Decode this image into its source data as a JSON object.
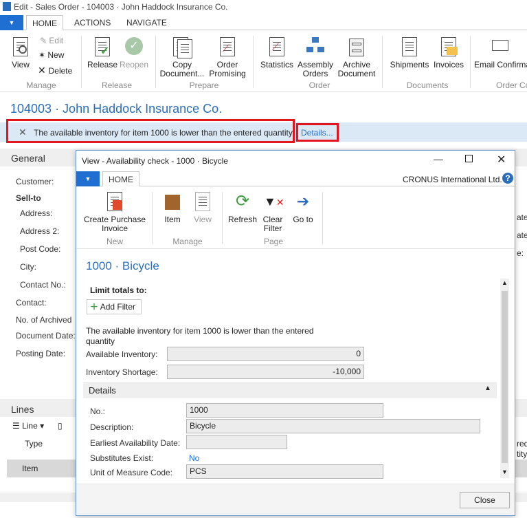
{
  "window": {
    "title": "Edit - Sales Order - 104003 · John Haddock Insurance Co."
  },
  "ribbon_tabs": [
    "HOME",
    "ACTIONS",
    "NAVIGATE"
  ],
  "ribbon": {
    "view": "View",
    "edit": "Edit",
    "new": "New",
    "delete": "Delete",
    "release": "Release",
    "reopen": "Reopen",
    "copy_document": "Copy Document...",
    "order_promising": "Order Promising",
    "statistics": "Statistics",
    "assembly_orders": "Assembly Orders",
    "archive_document": "Archive Document",
    "shipments": "Shipments",
    "invoices": "Invoices",
    "email_confirmation": "Email Confirmation...",
    "groups": {
      "manage": "Manage",
      "release": "Release",
      "prepare": "Prepare",
      "order": "Order",
      "documents": "Documents",
      "order_confirm": "Order Co"
    }
  },
  "page_title": "104003 · John Haddock Insurance Co.",
  "notification": {
    "text": "The available inventory for item 1000 is lower than the entered quantity.",
    "details": "Details..."
  },
  "general": {
    "header": "General",
    "labels": [
      "Customer:",
      "Sell-to",
      "Address:",
      "Address 2:",
      "Post Code:",
      "City:",
      "Contact No.:",
      "Contact:",
      "No. of Archived",
      "Document Date:",
      "Posting Date:"
    ],
    "right_fragments": [
      "ate:",
      "ate:",
      "e:"
    ]
  },
  "lines": {
    "header": "Lines",
    "line_menu": "Line",
    "col_type": "Type",
    "col_item": "Item",
    "right_col": [
      "red",
      "tity"
    ]
  },
  "dialog": {
    "title": "View - Availability check - 1000 · Bicycle",
    "tab": "HOME",
    "company": "CRONUS International Ltd.",
    "ribbon": {
      "create_purchase_invoice": "Create Purchase Invoice",
      "item": "Item",
      "view": "View",
      "refresh": "Refresh",
      "clear_filter": "Clear Filter",
      "go_to": "Go to",
      "groups": {
        "new": "New",
        "manage": "Manage",
        "page": "Page"
      }
    },
    "heading": "1000 · Bicycle",
    "limit_totals": "Limit totals to:",
    "add_filter": "Add Filter",
    "message": "The available inventory for item 1000 is lower than the entered quantity",
    "available_inventory_label": "Available Inventory:",
    "available_inventory_value": "0",
    "inventory_shortage_label": "Inventory Shortage:",
    "inventory_shortage_value": "-10,000",
    "details": {
      "header": "Details",
      "no_label": "No.:",
      "no_value": "1000",
      "description_label": "Description:",
      "description_value": "Bicycle",
      "earliest_label": "Earliest Availability Date:",
      "earliest_value": "",
      "substitutes_label": "Substitutes Exist:",
      "substitutes_value": "No",
      "uom_label": "Unit of Measure Code:",
      "uom_value": "PCS"
    },
    "close": "Close"
  },
  "colors": {
    "accent": "#1e6fd1",
    "title_blue": "#2a6ebb",
    "highlight": "#e2141d",
    "notification_bg": "#dbe9f7"
  }
}
